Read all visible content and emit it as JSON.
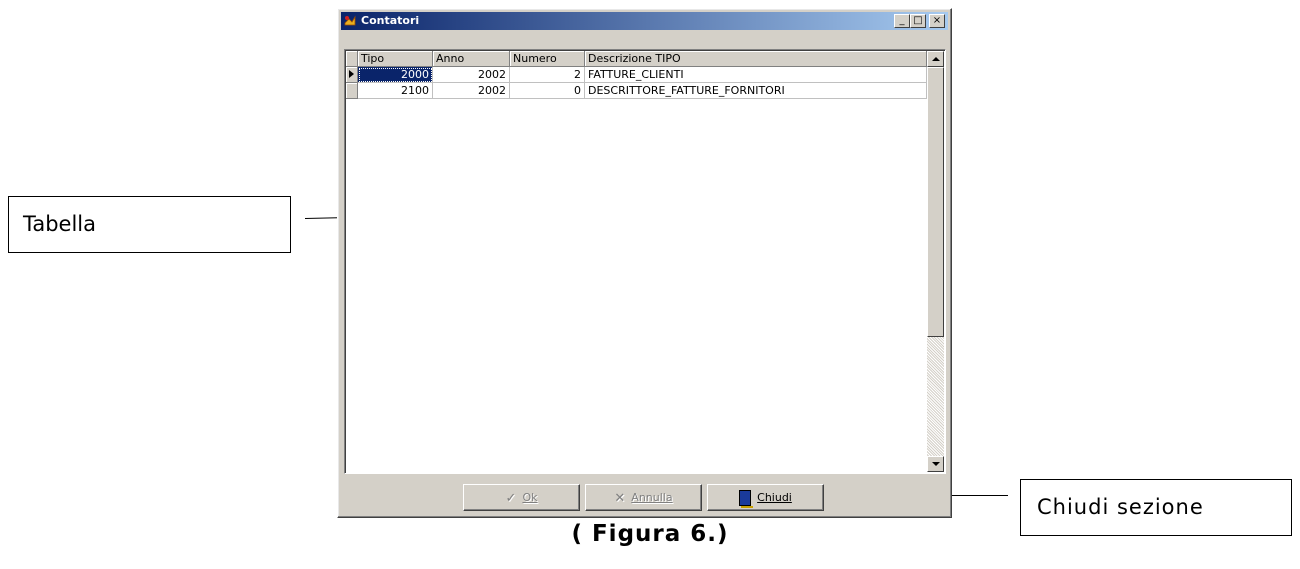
{
  "window": {
    "title": "Contatori",
    "controls": {
      "minimize": "_",
      "maximize": "□",
      "close": "×"
    }
  },
  "grid": {
    "columns": [
      "Tipo",
      "Anno",
      "Numero",
      "Descrizione TIPO"
    ],
    "rows": [
      {
        "tipo": "2000",
        "anno": "2002",
        "numero": "2",
        "descrizione": "FATTURE_CLIENTI",
        "selected": true
      },
      {
        "tipo": "2100",
        "anno": "2002",
        "numero": "0",
        "descrizione": "DESCRITTORE_FATTURE_FORNITORI",
        "selected": false
      }
    ]
  },
  "buttons": {
    "ok": {
      "label": "Ok",
      "icon": "check-icon",
      "enabled": false
    },
    "annulla": {
      "label": "Annulla",
      "icon": "cross-icon",
      "enabled": false
    },
    "chiudi": {
      "label": "Chiudi",
      "icon": "door-icon",
      "enabled": true
    }
  },
  "callouts": {
    "tabella": "Tabella",
    "chiudi": "Chiudi sezione"
  },
  "caption": "( Figura 6.)",
  "colors": {
    "titlebar_start": "#0a246a",
    "titlebar_end": "#a6caf0",
    "selection": "#0a246a"
  }
}
